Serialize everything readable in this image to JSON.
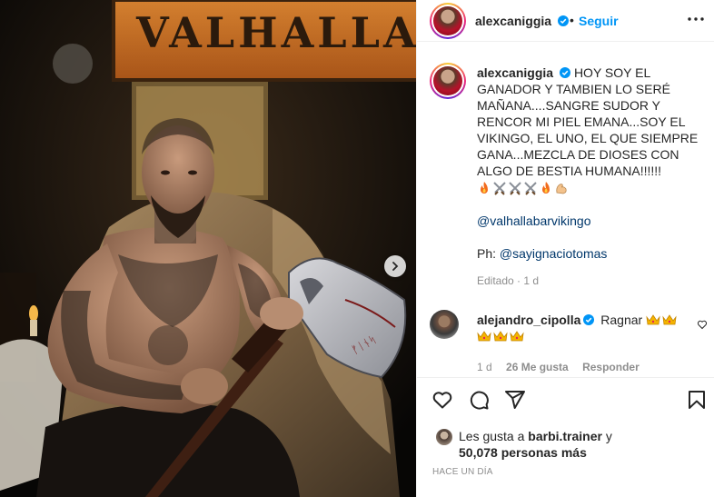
{
  "media": {
    "sign_text": "VALHALLA"
  },
  "header": {
    "username": "alexcaniggia",
    "dot": "•",
    "follow_label": "Seguir"
  },
  "caption": {
    "username": "alexcaniggia",
    "text": "HOY SOY EL GANADOR Y TAMBIEN LO SERÉ MAÑANA....SANGRE SUDOR Y RENCOR MI PIEL EMANA...SOY EL VIKINGO, EL UNO, EL QUE SIEMPRE GANA...MEZCLA DE DIOSES CON ALGO DE BESTIA HUMANA!!!!!!",
    "emojis": [
      "fire-emoji",
      "crossed-swords-emoji",
      "crossed-swords-emoji",
      "crossed-swords-emoji",
      "fire-emoji",
      "flexed-biceps-emoji"
    ],
    "mention": "@valhallabarvikingo",
    "ph_label": "Ph:",
    "ph_mention": "@sayignaciotomas",
    "edited": "Editado",
    "edited_dot": "·",
    "edited_time": "1 d"
  },
  "comment": {
    "username": "alejandro_cipolla",
    "text": "Ragnar",
    "emojis": [
      "crown-emoji",
      "crown-emoji",
      "crown-emoji",
      "crown-emoji",
      "crown-emoji"
    ],
    "time": "1 d",
    "likes": "26 Me gusta",
    "reply": "Responder"
  },
  "likes": {
    "prefix": "Les gusta a",
    "user": "barbi.trainer",
    "suffix": "y",
    "count_text": "50,078 personas más"
  },
  "time_ago": "HACE UN DÍA",
  "colors": {
    "accent": "#0095f6",
    "verified": "#0095f6",
    "muted": "#8e8e8e",
    "link": "#00376b"
  }
}
